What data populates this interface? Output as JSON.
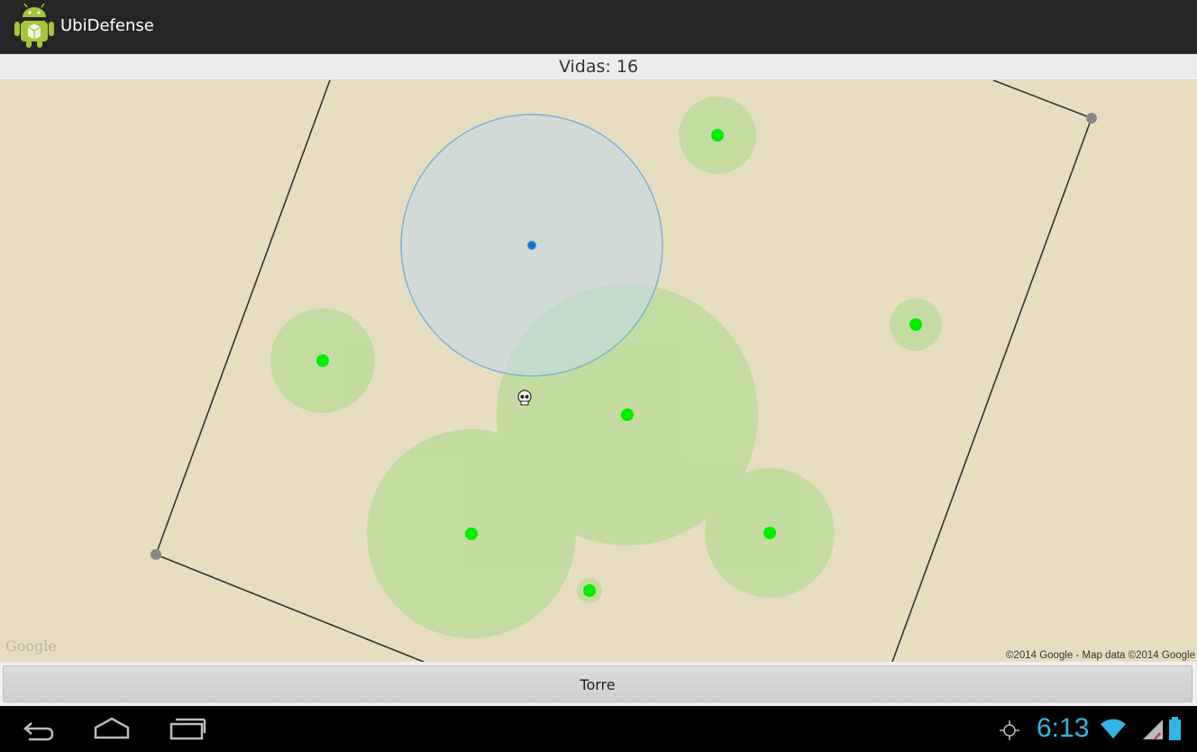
{
  "app": {
    "title": "UbiDefense",
    "icon": "android-robot-icon"
  },
  "status": {
    "lives_text": "Vidas: 16"
  },
  "map": {
    "background_color": "#e7dec2",
    "logo_text": "Google",
    "attribution": "©2014 Google - Map data ©2014 Google",
    "range_color": "#b7db94",
    "tower_color": "#00ee00",
    "player_range_color": "#a9c8dd"
  },
  "actions": {
    "tower_button_label": "Torre"
  },
  "system_bar": {
    "time": "6:13",
    "accent_color": "#33b5e5",
    "icons": [
      "back-icon",
      "home-icon",
      "recents-icon",
      "gps-icon",
      "wifi-icon",
      "signal-icon",
      "battery-icon"
    ]
  }
}
